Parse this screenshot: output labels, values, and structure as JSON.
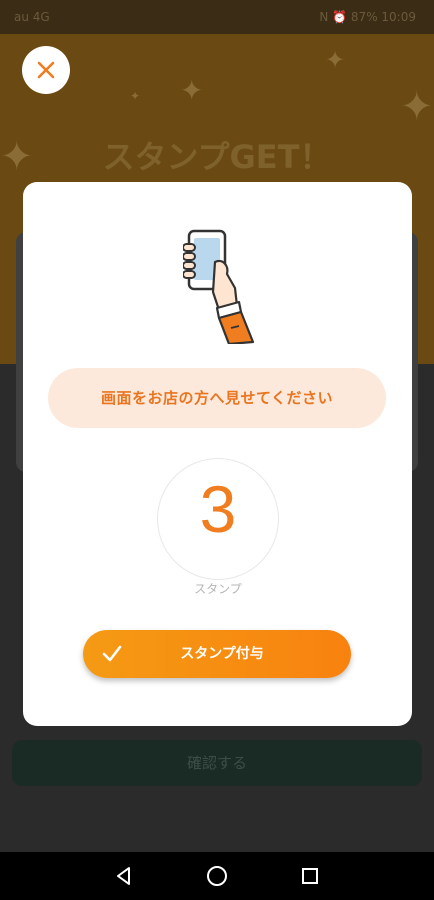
{
  "status_bar": {
    "left_text": "au 4G",
    "right_text": "N ⏰ 87% 10:09"
  },
  "hero": {
    "title": "スタンプGET！"
  },
  "modal": {
    "message": "画面をお店の方へ見せてください",
    "stamp_count": "3",
    "stamp_label": "スタンプ",
    "grant_button_label": "スタンプ付与"
  },
  "background": {
    "confirm_button_label": "確認する"
  },
  "colors": {
    "accent": "#f07d1f",
    "button": "#f7901a",
    "pill_bg": "#fde9dc"
  },
  "icons": [
    "close-icon",
    "hand-phone-icon",
    "check-icon",
    "back-icon",
    "home-icon",
    "recents-icon"
  ]
}
